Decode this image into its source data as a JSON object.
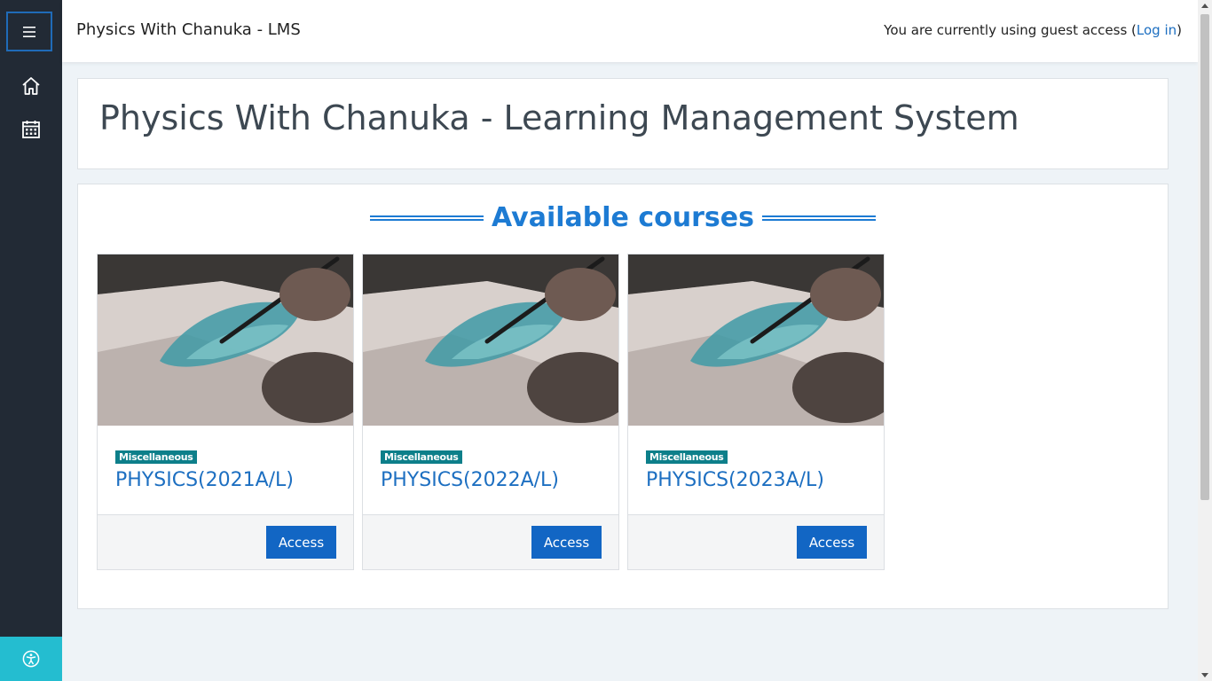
{
  "topbar": {
    "site_name": "Physics With Chanuka - LMS",
    "guest_text": "You are currently using guest access (",
    "login_label": "Log in",
    "guest_suffix": ")"
  },
  "page": {
    "title": "Physics With Chanuka - Learning Management System",
    "courses_heading": "Available courses"
  },
  "sidebar": {
    "icons": [
      "menu-icon",
      "home-icon",
      "calendar-icon",
      "accessibility-icon"
    ]
  },
  "courses": [
    {
      "category": "Miscellaneous",
      "name": "PHYSICS(2021A/L)",
      "button": "Access"
    },
    {
      "category": "Miscellaneous",
      "name": "PHYSICS(2022A/L)",
      "button": "Access"
    },
    {
      "category": "Miscellaneous",
      "name": "PHYSICS(2023A/L)",
      "button": "Access"
    }
  ],
  "colors": {
    "sidebar": "#222a35",
    "accent": "#1d7bd3",
    "button": "#1266c4",
    "badge": "#0d7f8a",
    "accessibility": "#24bdd0"
  }
}
